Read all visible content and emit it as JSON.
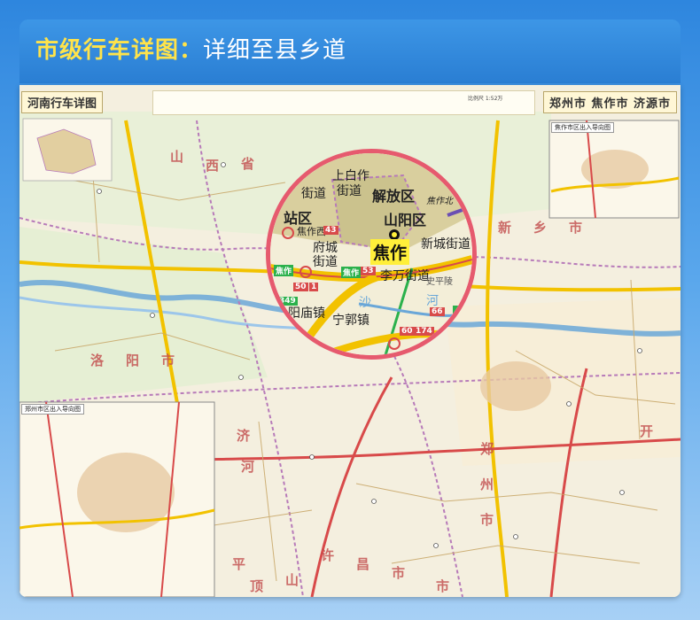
{
  "header": {
    "title_highlight": "市级行车详图：",
    "title_rest": "详细至县乡道"
  },
  "map": {
    "title_left": "河南行车详图",
    "title_right": "郑州市 焦作市 济源市",
    "scale_text": "比例尺 1:52万",
    "inset_top_right": "焦作市区出入导向图",
    "inset_bottom_left": "郑州市区出入导向图",
    "region_labels": [
      "山",
      "西",
      "省",
      "洛",
      "阳",
      "市",
      "新",
      "乡",
      "市",
      "郑",
      "州",
      "市",
      "开",
      "许",
      "昌",
      "市",
      "平",
      "顶",
      "山",
      "市",
      "济",
      "河"
    ]
  },
  "magnifier": {
    "labels": [
      "上白作",
      "解放区",
      "街道",
      "街道",
      "站区",
      "山阳区",
      "焦作北",
      "焦作西",
      "府城",
      "街道",
      "新城街道",
      "李万街道",
      "史平陵",
      "阳庙镇",
      "宁郭镇",
      "河",
      "沙",
      "修"
    ],
    "city_center": "焦作",
    "shields": [
      "43",
      "53",
      "50",
      "1",
      "349",
      "66",
      "60",
      "174"
    ],
    "highway_tags": [
      "焦作",
      "焦作"
    ]
  },
  "colors": {
    "frame_blue": "#2e86de",
    "highlight_yellow": "#ffe34a",
    "magnifier_ring": "#e65a6e",
    "river_blue": "#6aa7d8",
    "highway_yellow": "#f2c200",
    "highway_red": "#d84a4a",
    "county_purple": "#b77ab9"
  }
}
